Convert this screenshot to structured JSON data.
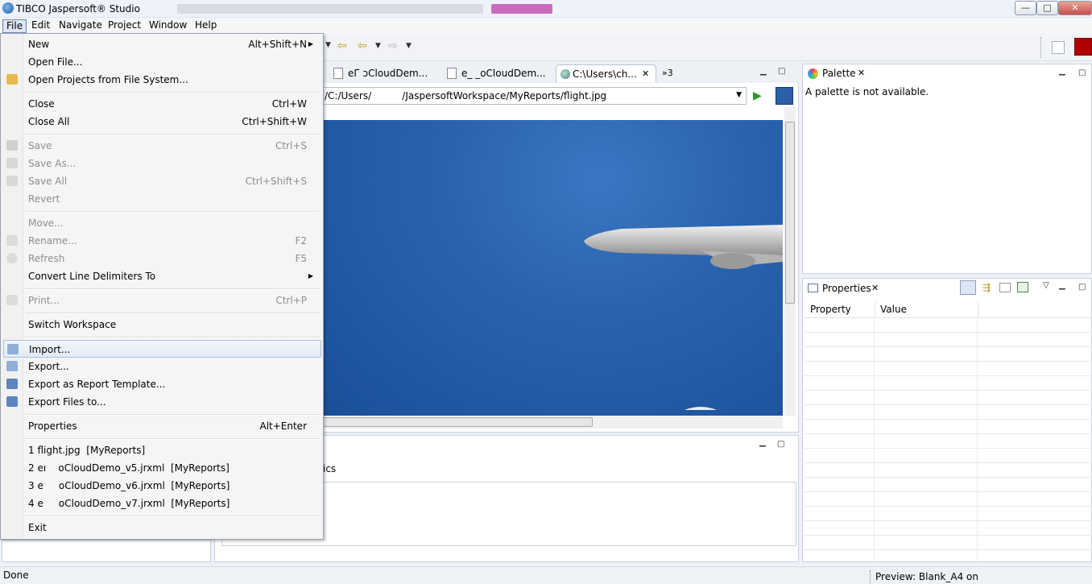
{
  "window": {
    "title": "TIBCO Jaspersoft® Studio",
    "min_label": "—",
    "max_label": "□",
    "close_label": "✕"
  },
  "menubar": [
    "File",
    "Edit",
    "Navigate",
    "Project",
    "Window",
    "Help"
  ],
  "file_menu": [
    {
      "label": "New",
      "accel": "Alt+Shift+N",
      "submenu": true,
      "disabled": false
    },
    {
      "label": "Open File...",
      "accel": "",
      "disabled": false
    },
    {
      "label": "Open Projects from File System...",
      "accel": "",
      "disabled": false
    },
    {
      "label": "Close",
      "accel": "Ctrl+W",
      "disabled": false
    },
    {
      "label": "Close All",
      "accel": "Ctrl+Shift+W",
      "disabled": false
    },
    {
      "label": "Save",
      "accel": "Ctrl+S",
      "disabled": true
    },
    {
      "label": "Save As...",
      "accel": "",
      "disabled": true
    },
    {
      "label": "Save All",
      "accel": "Ctrl+Shift+S",
      "disabled": true
    },
    {
      "label": "Revert",
      "accel": "",
      "disabled": true
    },
    {
      "label": "Move...",
      "accel": "",
      "disabled": true
    },
    {
      "label": "Rename...",
      "accel": "F2",
      "disabled": true
    },
    {
      "label": "Refresh",
      "accel": "F5",
      "disabled": true
    },
    {
      "label": "Convert Line Delimiters To",
      "accel": "",
      "submenu": true,
      "disabled": false
    },
    {
      "label": "Print...",
      "accel": "Ctrl+P",
      "disabled": true
    },
    {
      "label": "Switch Workspace",
      "accel": "",
      "disabled": false
    },
    {
      "label": "Import...",
      "accel": "",
      "disabled": false,
      "highlighted": true
    },
    {
      "label": "Export...",
      "accel": "",
      "disabled": false
    },
    {
      "label": "Export as Report Template...",
      "accel": "",
      "disabled": false
    },
    {
      "label": "Export Files to...",
      "accel": "",
      "disabled": false
    },
    {
      "label": "Properties",
      "accel": "Alt+Enter",
      "disabled": false
    },
    {
      "label": "1 flight.jpg  [MyReports]",
      "accel": "",
      "disabled": false
    },
    {
      "label": "2 eı    oCloudDemo_v5.jrxml  [MyReports]",
      "accel": "",
      "disabled": false
    },
    {
      "label": "3 e     oCloudDemo_v6.jrxml  [MyReports]",
      "accel": "",
      "disabled": false
    },
    {
      "label": "4 e     oCloudDemo_v7.jrxml  [MyReports]",
      "accel": "",
      "disabled": false
    },
    {
      "label": "Exit",
      "accel": "",
      "disabled": false
    }
  ],
  "editor": {
    "tabs": [
      "eГ  ɔCloudDem...",
      "e_ _oCloudDem...",
      "C:\\Users\\ch..."
    ],
    "overflow": "»3",
    "address": "/C:/Users/          /JaspersoftWorkspace/MyReports/flight.jpg"
  },
  "bottom_panel": {
    "text": "ics"
  },
  "palette": {
    "title": "Palette",
    "message": "A palette is not available."
  },
  "properties": {
    "title": "Properties",
    "columns": [
      "Property",
      "Value"
    ]
  },
  "status": {
    "left": "Done",
    "right": "Preview: Blank_A4 on"
  },
  "colors": {
    "menu_highlight": "#dce6f4",
    "sky": "#2a63ad",
    "disabled_text": "#8d8d8d"
  }
}
